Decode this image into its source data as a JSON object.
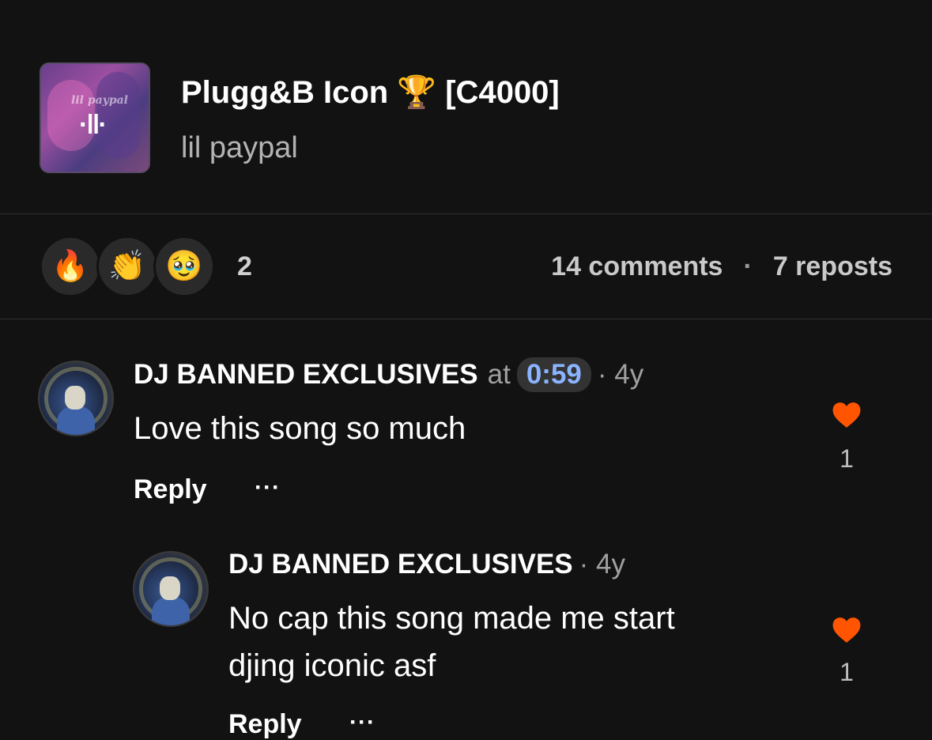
{
  "track": {
    "title": "Plugg&B Icon 🏆 [C4000]",
    "artist": "lil paypal",
    "cover_text": "lil paypal",
    "cover_icon": "waveform-icon"
  },
  "reactions": {
    "emojis": [
      "🔥",
      "👏",
      "🥹"
    ],
    "count": "2"
  },
  "stats": {
    "comments": "14 comments",
    "separator": "·",
    "reposts": "7 reposts"
  },
  "colors": {
    "background": "#121212",
    "heart": "#ff5500",
    "timestamp": "#8ab4ff"
  },
  "comments": [
    {
      "user": "DJ BANNED EXCLUSIVES",
      "at_label": "at",
      "timestamp": "0:59",
      "age": "· 4y",
      "text": "Love this song so much",
      "likes": "1",
      "reply_label": "Reply",
      "more_label": "···"
    },
    {
      "user": "DJ BANNED EXCLUSIVES",
      "age": "· 4y",
      "text_line1": "No cap this song made me start",
      "text_line2": "djing iconic asf",
      "likes": "1",
      "reply_label": "Reply",
      "more_label": "···"
    }
  ]
}
